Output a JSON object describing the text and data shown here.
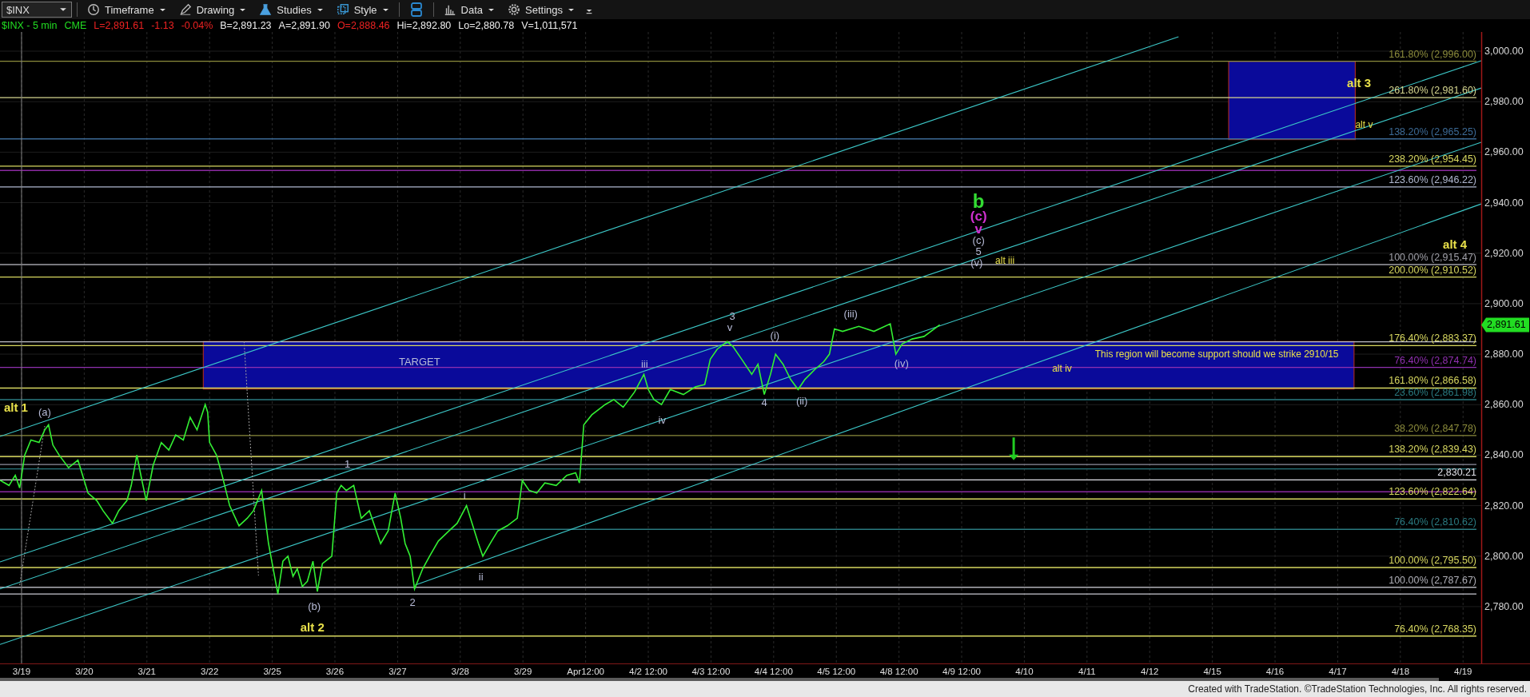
{
  "toolbar": {
    "symbol": "$INX",
    "items": [
      {
        "kind": "menu",
        "label": "Timeframe"
      },
      {
        "kind": "menu",
        "label": "Drawing"
      },
      {
        "kind": "menu",
        "label": "Studies"
      },
      {
        "kind": "menu",
        "label": "Style"
      },
      {
        "kind": "separator"
      },
      {
        "kind": "icon"
      },
      {
        "kind": "separator"
      },
      {
        "kind": "menu",
        "label": "Data"
      },
      {
        "kind": "menu",
        "label": "Settings"
      },
      {
        "kind": "more"
      }
    ]
  },
  "quote_line": [
    {
      "text": "$INX - 5 min",
      "color": "#22dd22"
    },
    {
      "text": "CME",
      "color": "#22dd22"
    },
    {
      "text": "L=2,891.61",
      "color": "#ee2222"
    },
    {
      "text": "-1.13",
      "color": "#ee2222"
    },
    {
      "text": "-0.04%",
      "color": "#ee2222"
    },
    {
      "text": "B=2,891.23",
      "color": "#f0f0f0"
    },
    {
      "text": "A=2,891.90",
      "color": "#f0f0f0"
    },
    {
      "text": "O=2,888.46",
      "color": "#ee2222"
    },
    {
      "text": "Hi=2,892.80",
      "color": "#f0f0f0"
    },
    {
      "text": "Lo=2,880.78",
      "color": "#f0f0f0"
    },
    {
      "text": "V=1,011,571",
      "color": "#f0f0f0"
    }
  ],
  "chart": {
    "price_axis": [
      "3,000.00",
      "2,980.00",
      "2,960.00",
      "2,940.00",
      "2,920.00",
      "2,900.00",
      "2,880.00",
      "2,860.00",
      "2,840.00",
      "2,820.00",
      "2,800.00",
      "2,780.00"
    ],
    "current_price": {
      "text": "2,891.61",
      "color": "#22dd22"
    },
    "date_axis": [
      "3/19",
      "3/20",
      "3/21",
      "3/22",
      "3/25",
      "3/26",
      "3/27",
      "3/28",
      "3/29",
      "Apr12:00",
      "4/2 12:00",
      "4/3 12:00",
      "4/4 12:00",
      "4/5 12:00",
      "4/8 12:00",
      "4/9 12:00",
      "4/10",
      "4/11",
      "4/12",
      "4/15",
      "4/16",
      "4/17",
      "4/18",
      "4/19"
    ],
    "levels": [
      {
        "color": "#8c8c3c",
        "label": "161.80% (2,996.00)"
      },
      {
        "color": "#d6d690",
        "label": "261.80% (2,981.60)"
      },
      {
        "color": "#3c6a96",
        "label": "138.20% (2,965.25)"
      },
      {
        "color": "#d8d860",
        "label": "238.20% (2,954.45)"
      },
      {
        "color": "#b0b8d0",
        "label": "123.60% (2,946.22)"
      },
      {
        "color": "#a0a0a8",
        "label": "100.00% (2,915.47)"
      },
      {
        "color": "#d8d860",
        "label": "200.00% (2,910.52)"
      },
      {
        "color": "#d8d860",
        "label": "176.40% (2,883.37)"
      },
      {
        "color": "#9030b0",
        "label": "76.40% (2,874.74)"
      },
      {
        "color": "#d8d860",
        "label": "161.80% (2,866.58)"
      },
      {
        "color": "#2a7a80",
        "label": "23.60% (2,861.98)"
      },
      {
        "color": "#8c8c3c",
        "label": "38.20% (2,847.78)"
      },
      {
        "color": "#d8d860",
        "label": "138.20% (2,839.43)"
      },
      {
        "color": "#e0e0e8",
        "label": "2,830.21"
      },
      {
        "color": "#d8d860",
        "label": "123.60% (2,822.64)"
      },
      {
        "color": "#2a7a80",
        "label": "76.40% (2,810.62)"
      },
      {
        "color": "#d8d860",
        "label": "100.00% (2,795.50)"
      },
      {
        "color": "#b0b0b8",
        "label": "100.00% (2,787.67)"
      },
      {
        "color": "#d8d860",
        "label": "76.40% (2,768.35)"
      }
    ],
    "labels": [
      {
        "kind": "alt",
        "text": "alt 1"
      },
      {
        "kind": "wave",
        "text": "(a)"
      },
      {
        "kind": "wave",
        "text": "1"
      },
      {
        "kind": "wave",
        "text": "(b)"
      },
      {
        "kind": "alt",
        "text": "alt 2"
      },
      {
        "kind": "wave",
        "text": "2"
      },
      {
        "kind": "wave",
        "text": "i"
      },
      {
        "kind": "wave",
        "text": "ii"
      },
      {
        "kind": "wave",
        "text": "iii"
      },
      {
        "kind": "wave",
        "text": "iv"
      },
      {
        "kind": "wave",
        "text": "3"
      },
      {
        "kind": "wave",
        "text": "v"
      },
      {
        "kind": "wave",
        "text": "(i)"
      },
      {
        "kind": "wave",
        "text": "4"
      },
      {
        "kind": "wave",
        "text": "(ii)"
      },
      {
        "kind": "wave",
        "text": "(iii)"
      },
      {
        "kind": "wave",
        "text": "(iv)"
      },
      {
        "kind": "big",
        "text": "b"
      },
      {
        "kind": "mid",
        "text": "(c)"
      },
      {
        "kind": "mid",
        "text": "v"
      },
      {
        "kind": "wave",
        "text": "(c)"
      },
      {
        "kind": "wave",
        "text": "5"
      },
      {
        "kind": "wave",
        "text": "(v)"
      },
      {
        "kind": "note",
        "text": "alt iii"
      },
      {
        "kind": "wave",
        "text": "TARGET"
      },
      {
        "kind": "note",
        "text": "This region will become support should we strike 2910/15"
      },
      {
        "kind": "note",
        "text": "alt iv"
      },
      {
        "kind": "alt",
        "text": "alt 3"
      },
      {
        "kind": "note",
        "text": "alt v"
      },
      {
        "kind": "alt",
        "text": "alt 4"
      }
    ]
  },
  "footer": "Created with TradeStation. ©TradeStation Technologies, Inc. All rights reserved."
}
